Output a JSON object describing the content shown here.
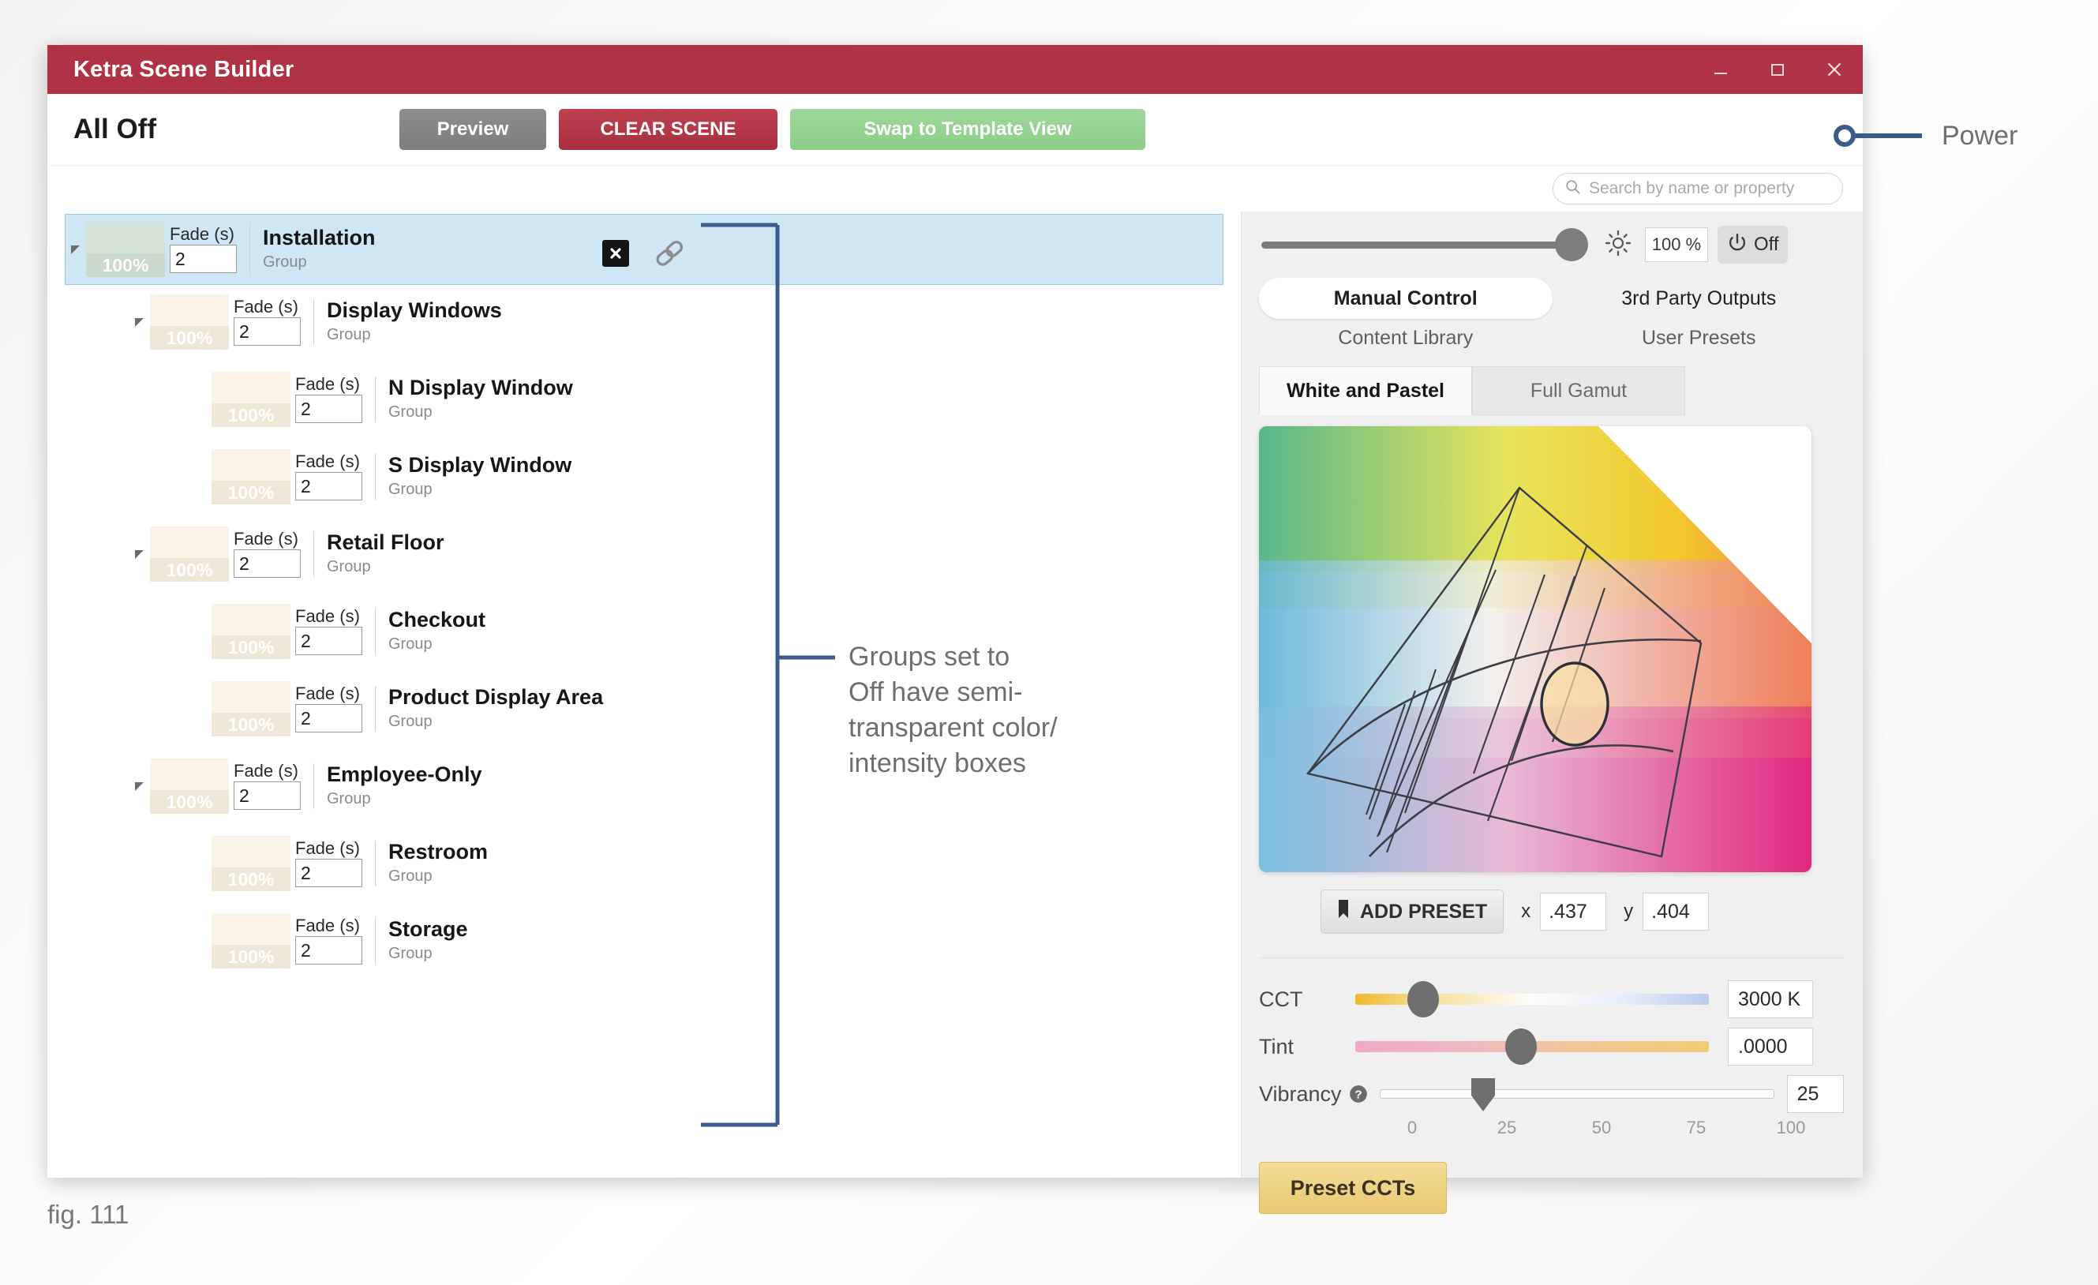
{
  "window": {
    "title": "Ketra Scene Builder",
    "buttons": {
      "minimize": "minimize-icon",
      "maximize": "maximize-icon",
      "close": "close-icon"
    }
  },
  "header": {
    "scene_name": "All Off",
    "preview_label": "Preview",
    "clear_label": "CLEAR SCENE",
    "swap_label": "Swap to Template View"
  },
  "search": {
    "placeholder": "Search by name or property",
    "value": ""
  },
  "tree": {
    "rows": [
      {
        "name": "Installation",
        "type": "Group",
        "fade_label": "Fade (s)",
        "fade": "2",
        "intensity": "100%",
        "depth": 0,
        "selected": true,
        "has_twisty": true,
        "swatch": "off-pale-green"
      },
      {
        "name": "Display Windows",
        "type": "Group",
        "fade_label": "Fade (s)",
        "fade": "2",
        "intensity": "100%",
        "depth": 1,
        "selected": false,
        "has_twisty": true,
        "swatch": "off-cream"
      },
      {
        "name": "N Display Window",
        "type": "Group",
        "fade_label": "Fade (s)",
        "fade": "2",
        "intensity": "100%",
        "depth": 2,
        "selected": false,
        "has_twisty": false,
        "swatch": "off-cream"
      },
      {
        "name": "S Display Window",
        "type": "Group",
        "fade_label": "Fade (s)",
        "fade": "2",
        "intensity": "100%",
        "depth": 2,
        "selected": false,
        "has_twisty": false,
        "swatch": "off-cream"
      },
      {
        "name": "Retail Floor",
        "type": "Group",
        "fade_label": "Fade (s)",
        "fade": "2",
        "intensity": "100%",
        "depth": 1,
        "selected": false,
        "has_twisty": true,
        "swatch": "off-cream"
      },
      {
        "name": "Checkout",
        "type": "Group",
        "fade_label": "Fade (s)",
        "fade": "2",
        "intensity": "100%",
        "depth": 2,
        "selected": false,
        "has_twisty": false,
        "swatch": "off-cream"
      },
      {
        "name": "Product Display Area",
        "type": "Group",
        "fade_label": "Fade (s)",
        "fade": "2",
        "intensity": "100%",
        "depth": 2,
        "selected": false,
        "has_twisty": false,
        "swatch": "off-cream"
      },
      {
        "name": "Employee-Only",
        "type": "Group",
        "fade_label": "Fade (s)",
        "fade": "2",
        "intensity": "100%",
        "depth": 1,
        "selected": false,
        "has_twisty": true,
        "swatch": "off-cream"
      },
      {
        "name": "Restroom",
        "type": "Group",
        "fade_label": "Fade (s)",
        "fade": "2",
        "intensity": "100%",
        "depth": 2,
        "selected": false,
        "has_twisty": false,
        "swatch": "off-cream"
      },
      {
        "name": "Storage",
        "type": "Group",
        "fade_label": "Fade (s)",
        "fade": "2",
        "intensity": "100%",
        "depth": 2,
        "selected": false,
        "has_twisty": false,
        "swatch": "off-cream"
      }
    ]
  },
  "controls": {
    "brightness": {
      "value_label": "100 %",
      "slider_percent": 93
    },
    "power": {
      "label": "Off",
      "state": "off"
    },
    "tabs_primary": [
      {
        "label": "Manual Control",
        "active": true
      },
      {
        "label": "3rd Party Outputs",
        "active": false
      }
    ],
    "tabs_secondary": [
      {
        "label": "Content Library",
        "active": false
      },
      {
        "label": "User Presets",
        "active": false
      }
    ],
    "gamut_tabs": [
      {
        "label": "White and Pastel",
        "active": true
      },
      {
        "label": "Full Gamut",
        "active": false
      }
    ],
    "add_preset_label": "ADD PRESET",
    "x_label": "x",
    "x_value": ".437",
    "y_label": "y",
    "y_value": ".404",
    "sliders": [
      {
        "name": "CCT",
        "value": "3000 K",
        "knob_percent": 19
      },
      {
        "name": "Tint",
        "value": ".0000",
        "knob_percent": 47
      },
      {
        "name": "Vibrancy",
        "value": "25",
        "knob_percent": 25
      }
    ],
    "vibrancy_ticks": [
      "0",
      "25",
      "50",
      "75",
      "100"
    ],
    "preset_ccts_label": "Preset CCTs"
  },
  "annotations": {
    "power_note": "Power",
    "groups_note_lines": [
      "Groups set to",
      "Off have semi-",
      "transparent color/",
      "intensity boxes"
    ],
    "figure_caption": "fig. 111"
  },
  "colors": {
    "titlebar": "#b03345",
    "clear_button": "#bf4150",
    "swap_button": "#9ed89a",
    "preview_button": "#8d8d8d",
    "selected_row": "#cfe6f5",
    "annotation_line": "#3b5c8a",
    "preset_cct_button": "#e7c96f"
  }
}
